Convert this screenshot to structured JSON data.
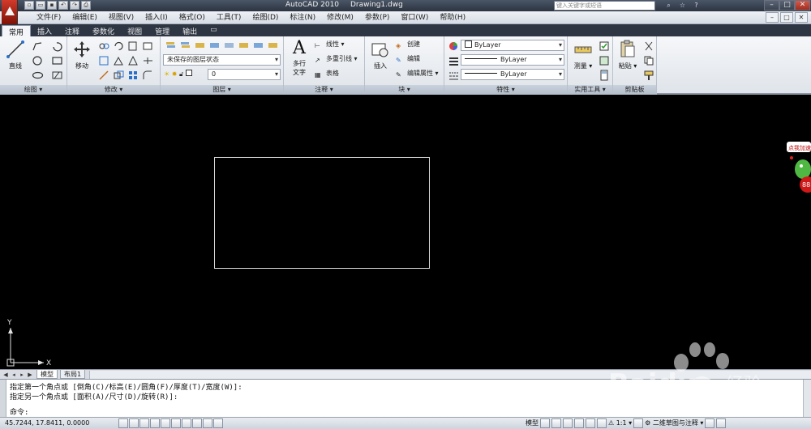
{
  "window": {
    "app_title": "AutoCAD 2010",
    "doc_title": "Drawing1.dwg",
    "search_placeholder": "键入关键字或短语",
    "min": "–",
    "max": "□",
    "close": "✕"
  },
  "qat": [
    "new-icon",
    "open-icon",
    "save-icon",
    "undo-icon",
    "redo-icon",
    "plot-icon"
  ],
  "menubar": {
    "items": [
      "文件(F)",
      "编辑(E)",
      "视图(V)",
      "插入(I)",
      "格式(O)",
      "工具(T)",
      "绘图(D)",
      "标注(N)",
      "修改(M)",
      "参数(P)",
      "窗口(W)",
      "帮助(H)"
    ]
  },
  "ribbon": {
    "tabs": [
      "常用",
      "插入",
      "注释",
      "参数化",
      "视图",
      "管理",
      "输出"
    ],
    "active_tab": "常用",
    "panels": {
      "draw": {
        "title": "绘图",
        "line_label": "直线"
      },
      "modify": {
        "title": "修改",
        "move_label": "移动"
      },
      "layers": {
        "title": "图层",
        "state": "未保存的图层状态",
        "layer": "0"
      },
      "annotation": {
        "title": "注释",
        "mtext_label": "多行\n文字",
        "mtext_l1": "多行",
        "mtext_l2": "文字",
        "linear": "线性",
        "mleader": "多重引线",
        "table": "表格"
      },
      "block": {
        "title": "块",
        "insert": "插入",
        "create": "创建",
        "edit": "编辑",
        "edit_attr": "编辑属性"
      },
      "properties": {
        "title": "特性",
        "color": "ByLayer",
        "linetype": "ByLayer",
        "lineweight": "ByLayer"
      },
      "utilities": {
        "title": "实用工具",
        "measure": "测量"
      },
      "clipboard": {
        "title": "剪贴板",
        "paste": "粘贴"
      }
    }
  },
  "layout_tabs": {
    "model": "模型",
    "layout1": "布局1"
  },
  "command": {
    "line1": "指定第一个角点或 [倒角(C)/标高(E)/圆角(F)/厚度(T)/宽度(W)]:",
    "line2": "指定另一个角点或 [面积(A)/尺寸(D)/旋转(R)]:",
    "prompt": "命令:"
  },
  "status": {
    "coords": "45.7244,  17.8411, 0.0000",
    "model": "模型",
    "scale": "1:1",
    "workspace": "二维草图与注释"
  },
  "ucs": {
    "y": "Y",
    "x": "X"
  },
  "promo": {
    "text": "点我加速",
    "num": "88"
  },
  "watermark": {
    "brand": "Baidu",
    "cn": "经验",
    "url": "jingyan.baidu.com"
  },
  "colors": {
    "canvas": "#000000",
    "title_bar": "#2c3440",
    "ribbon": "#e6eaef"
  }
}
